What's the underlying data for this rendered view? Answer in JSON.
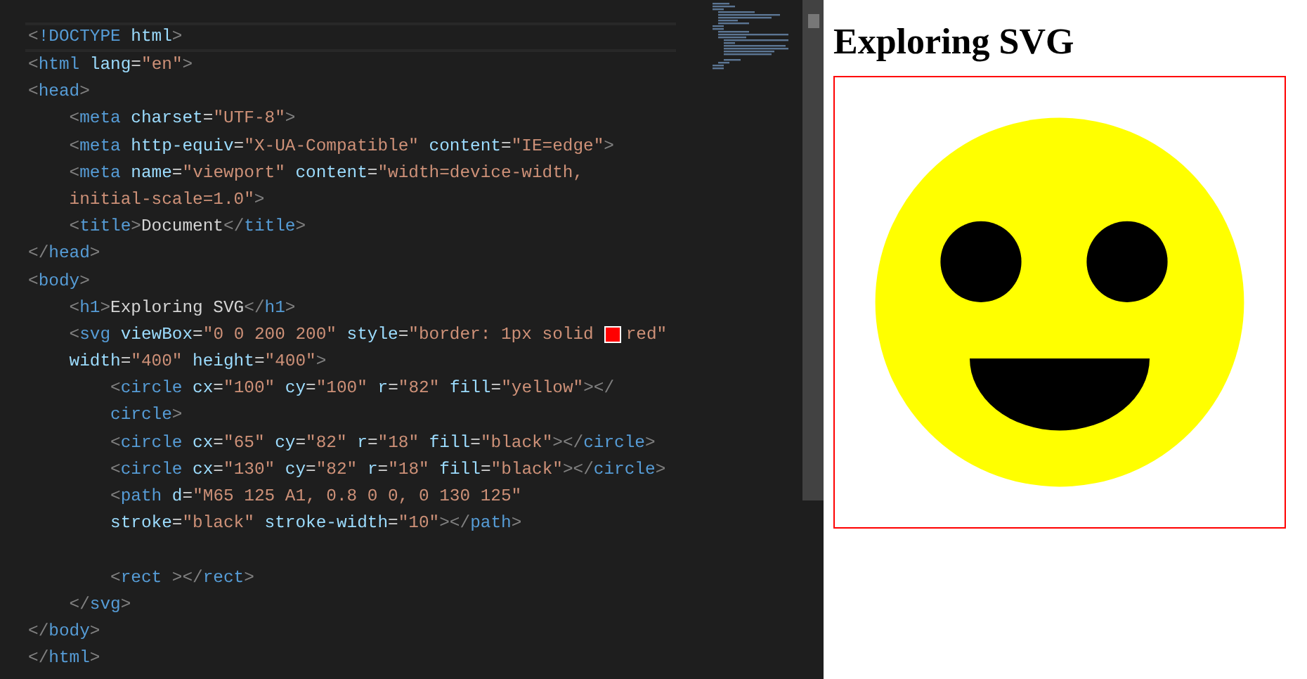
{
  "editor": {
    "lines": [
      {
        "tokens": [
          {
            "p": "<"
          },
          {
            "tag": "!DOCTYPE"
          },
          {
            "attr": " html"
          },
          {
            "p": ">"
          }
        ]
      },
      {
        "tokens": [
          {
            "p": "<"
          },
          {
            "tag": "html"
          },
          {
            "attr": " lang"
          },
          {
            "eq": "="
          },
          {
            "str": "\"en\""
          },
          {
            "p": ">"
          }
        ]
      },
      {
        "tokens": [
          {
            "p": "<"
          },
          {
            "tag": "head"
          },
          {
            "p": ">"
          }
        ]
      },
      {
        "tokens": [
          {
            "p": "    <"
          },
          {
            "tag": "meta"
          },
          {
            "attr": " charset"
          },
          {
            "eq": "="
          },
          {
            "str": "\"UTF-8\""
          },
          {
            "p": ">"
          }
        ]
      },
      {
        "tokens": [
          {
            "p": "    <"
          },
          {
            "tag": "meta"
          },
          {
            "attr": " http-equiv"
          },
          {
            "eq": "="
          },
          {
            "str": "\"X-UA-Compatible\""
          },
          {
            "attr": " content"
          },
          {
            "eq": "="
          },
          {
            "str": "\"IE=edge\""
          },
          {
            "p": ">"
          }
        ]
      },
      {
        "tokens": [
          {
            "p": "    <"
          },
          {
            "tag": "meta"
          },
          {
            "attr": " name"
          },
          {
            "eq": "="
          },
          {
            "str": "\"viewport\""
          },
          {
            "attr": " content"
          },
          {
            "eq": "="
          },
          {
            "str": "\"width=device-width,"
          }
        ]
      },
      {
        "tokens": [
          {
            "str": "    initial-scale=1.0\""
          },
          {
            "p": ">"
          }
        ]
      },
      {
        "tokens": [
          {
            "p": "    <"
          },
          {
            "tag": "title"
          },
          {
            "p": ">"
          },
          {
            "txt": "Document"
          },
          {
            "p": "</"
          },
          {
            "tag": "title"
          },
          {
            "p": ">"
          }
        ]
      },
      {
        "tokens": [
          {
            "p": "</"
          },
          {
            "tag": "head"
          },
          {
            "p": ">"
          }
        ]
      },
      {
        "tokens": [
          {
            "p": "<"
          },
          {
            "tag": "body"
          },
          {
            "p": ">"
          }
        ]
      },
      {
        "tokens": [
          {
            "p": "    <"
          },
          {
            "tag": "h1"
          },
          {
            "p": ">"
          },
          {
            "txt": "Exploring SVG"
          },
          {
            "p": "</"
          },
          {
            "tag": "h1"
          },
          {
            "p": ">"
          }
        ]
      },
      {
        "tokens": [
          {
            "p": "    <"
          },
          {
            "tag": "svg"
          },
          {
            "attr": " viewBox"
          },
          {
            "eq": "="
          },
          {
            "str": "\"0 0 200 200\""
          },
          {
            "attr": " style"
          },
          {
            "eq": "="
          },
          {
            "str": "\"border: 1px solid"
          },
          {
            "color": "#ff0000"
          },
          {
            "str": "red\""
          }
        ]
      },
      {
        "tokens": [
          {
            "attr": "    width"
          },
          {
            "eq": "="
          },
          {
            "str": "\"400\""
          },
          {
            "attr": " height"
          },
          {
            "eq": "="
          },
          {
            "str": "\"400\""
          },
          {
            "p": ">"
          }
        ]
      },
      {
        "tokens": [
          {
            "p": "        <"
          },
          {
            "tag": "circle"
          },
          {
            "attr": " cx"
          },
          {
            "eq": "="
          },
          {
            "str": "\"100\""
          },
          {
            "attr": " cy"
          },
          {
            "eq": "="
          },
          {
            "str": "\"100\""
          },
          {
            "attr": " r"
          },
          {
            "eq": "="
          },
          {
            "str": "\"82\""
          },
          {
            "attr": " fill"
          },
          {
            "eq": "="
          },
          {
            "str": "\"yellow\""
          },
          {
            "p": "></"
          }
        ]
      },
      {
        "tokens": [
          {
            "tag": "        circle"
          },
          {
            "p": ">"
          }
        ]
      },
      {
        "tokens": [
          {
            "p": "        <"
          },
          {
            "tag": "circle"
          },
          {
            "attr": " cx"
          },
          {
            "eq": "="
          },
          {
            "str": "\"65\""
          },
          {
            "attr": " cy"
          },
          {
            "eq": "="
          },
          {
            "str": "\"82\""
          },
          {
            "attr": " r"
          },
          {
            "eq": "="
          },
          {
            "str": "\"18\""
          },
          {
            "attr": " fill"
          },
          {
            "eq": "="
          },
          {
            "str": "\"black\""
          },
          {
            "p": "></"
          },
          {
            "tag": "circle"
          },
          {
            "p": ">"
          }
        ]
      },
      {
        "tokens": [
          {
            "p": "        <"
          },
          {
            "tag": "circle"
          },
          {
            "attr": " cx"
          },
          {
            "eq": "="
          },
          {
            "str": "\"130\""
          },
          {
            "attr": " cy"
          },
          {
            "eq": "="
          },
          {
            "str": "\"82\""
          },
          {
            "attr": " r"
          },
          {
            "eq": "="
          },
          {
            "str": "\"18\""
          },
          {
            "attr": " fill"
          },
          {
            "eq": "="
          },
          {
            "str": "\"black\""
          },
          {
            "p": "></"
          },
          {
            "tag": "circle"
          },
          {
            "p": ">"
          }
        ]
      },
      {
        "tokens": [
          {
            "p": "        <"
          },
          {
            "tag": "path"
          },
          {
            "attr": " d"
          },
          {
            "eq": "="
          },
          {
            "str": "\"M65 125 A1, 0.8 0 0, 0 130 125\""
          }
        ]
      },
      {
        "tokens": [
          {
            "attr": "        stroke"
          },
          {
            "eq": "="
          },
          {
            "str": "\"black\""
          },
          {
            "attr": " stroke-width"
          },
          {
            "eq": "="
          },
          {
            "str": "\"10\""
          },
          {
            "p": "></"
          },
          {
            "tag": "path"
          },
          {
            "p": ">"
          }
        ]
      },
      {
        "space_before": true,
        "tokens": [
          {
            "p": "        <"
          },
          {
            "tag": "rect"
          },
          {
            "p": " ></"
          },
          {
            "tag": "rect"
          },
          {
            "p": ">"
          }
        ]
      },
      {
        "tokens": [
          {
            "p": "    </"
          },
          {
            "tag": "svg"
          },
          {
            "p": ">"
          }
        ]
      },
      {
        "tokens": [
          {
            "p": "</"
          },
          {
            "tag": "body"
          },
          {
            "p": ">"
          }
        ]
      },
      {
        "tokens": [
          {
            "p": "</"
          },
          {
            "tag": "html"
          },
          {
            "p": ">"
          }
        ]
      }
    ]
  },
  "preview": {
    "heading": "Exploring SVG"
  }
}
